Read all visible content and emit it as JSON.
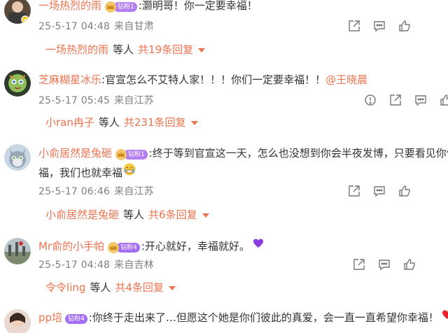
{
  "comments": [
    {
      "username": "一场热烈的雨",
      "badge": "钻粉1",
      "text": ":灏明哥！你一定要幸福！",
      "date": "25-5-17 04:48",
      "location": "来自甘肃",
      "reply_user": "一场热烈的雨",
      "reply_mid": "等人",
      "reply_count": "共19条回复"
    },
    {
      "username": "芝麻糊星冰乐",
      "text": ":官宣怎么不艾特人家！！！你们一定要幸福！！",
      "mention": "@王晓晨",
      "date": "25-5-17 05:45",
      "location": "来自江苏",
      "reply_user": "小ran冉子",
      "reply_mid": "等人",
      "reply_count": "共231条回复"
    },
    {
      "username": "小俞居然是兔砸",
      "badge": "钻粉1",
      "text": ":终于等到官宣这一天，怎么也没想到你会半夜发博，只要看见你俩",
      "text2": "福，我们也就幸福",
      "date": "25-5-17 06:46",
      "location": "来自江苏",
      "reply_user": "小俞居然是兔砸",
      "reply_mid": "等人",
      "reply_count": "共6条回复"
    },
    {
      "username": "Mr俞的小手帕",
      "badge": "钻粉4",
      "text": ":开心就好，幸福就好。",
      "date": "25-5-17 04:48",
      "location": "来自吉林",
      "reply_user": "令令ling",
      "reply_mid": "等人",
      "reply_count": "共4条回复"
    },
    {
      "username": "pp培",
      "badge": "钻粉4",
      "text": ":你终于走出来了…但愿这个她是你们彼此的真爱，会一直一直希望你幸福！"
    }
  ],
  "icons": {
    "share": "share-icon",
    "comment": "comment-icon",
    "report": "report-icon",
    "like": "like-icon"
  },
  "colors": {
    "username": "#eb7350",
    "meta": "#808080",
    "badge": "#b37cf0"
  }
}
